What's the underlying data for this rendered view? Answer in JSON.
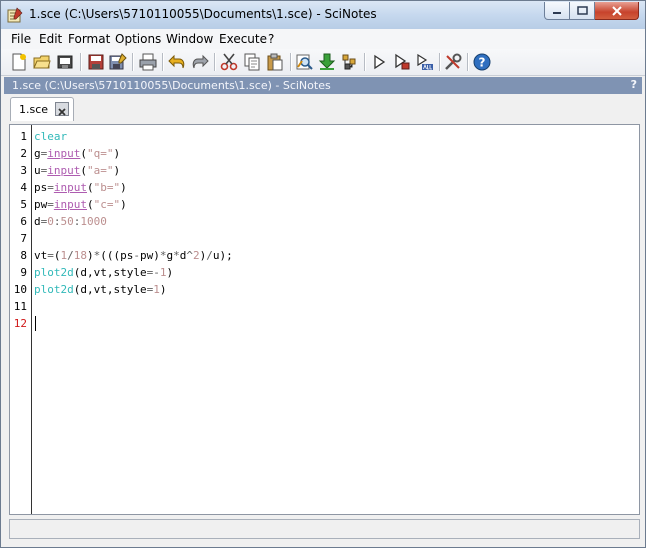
{
  "window": {
    "title": "1.sce (C:\\Users\\5710110055\\Documents\\1.sce) - SciNotes"
  },
  "menu": [
    "File",
    "Edit",
    "Format",
    "Options",
    "Window",
    "Execute",
    "?"
  ],
  "toolbar": {
    "icons": [
      "new-file-icon",
      "open-file-icon",
      "open-recent-icon",
      "save-icon",
      "save-as-icon",
      "print-icon",
      "undo-icon",
      "redo-icon",
      "cut-icon",
      "copy-icon",
      "paste-icon",
      "find-replace-icon",
      "load-execute-icon",
      "execute-options-icon",
      "execute-icon",
      "execute-with-echo-icon",
      "execute-all-icon",
      "preferences-icon",
      "help-icon"
    ]
  },
  "path_bar": {
    "text": "1.sce (C:\\Users\\5710110055\\Documents\\1.sce) - SciNotes",
    "help": "?"
  },
  "tab": {
    "label": "1.sce"
  },
  "editor": {
    "line_numbers": [
      "1",
      "2",
      "3",
      "4",
      "5",
      "6",
      "7",
      "8",
      "9",
      "10",
      "11",
      "12"
    ],
    "current_line": "12",
    "lines": [
      "clear",
      "g=input(\"q=\")",
      "u=input(\"a=\")",
      "ps=input(\"b=\")",
      "pw=input(\"c=\")",
      "d=0:50:1000",
      "",
      "vt=(1/18)*(((ps-pw)*g*d^2)/u);",
      "plot2d(d,vt,style=-1)",
      "plot2d(d,vt,style=1)",
      "",
      ""
    ]
  },
  "colors": {
    "keyword": "#32b9b9",
    "function": "#ae5cb0",
    "string": "#bc8f8f",
    "current_line_number": "#d01818",
    "path_bar": "#7f93b3"
  }
}
